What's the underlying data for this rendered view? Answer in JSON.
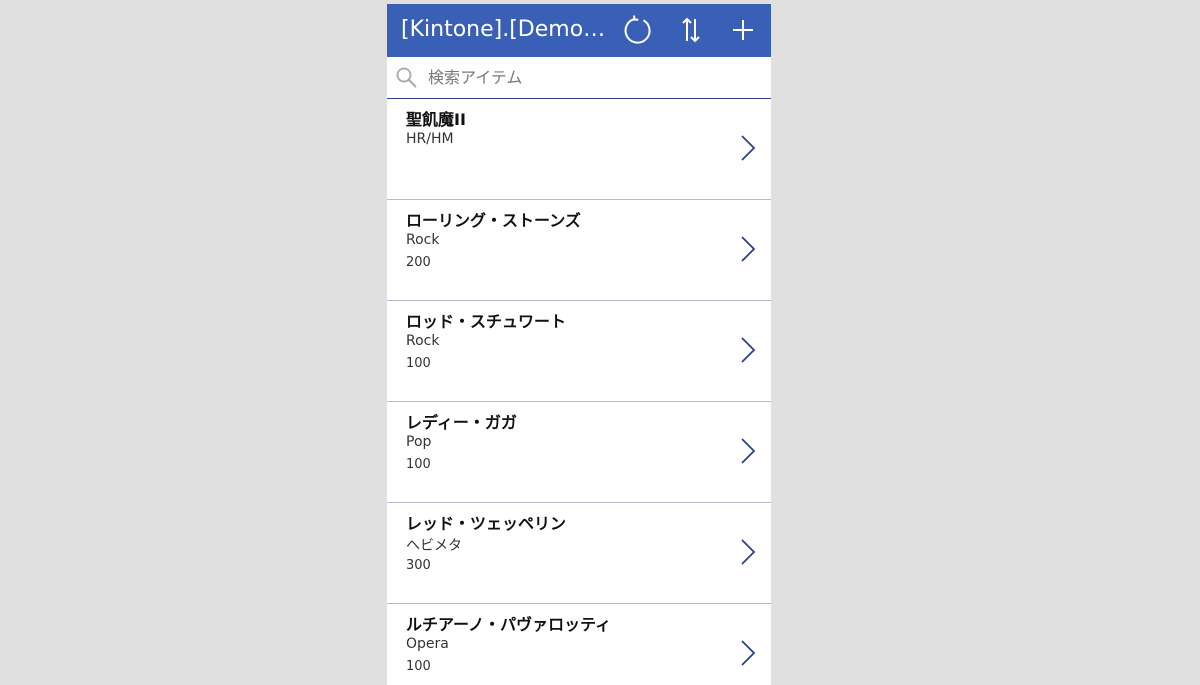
{
  "header": {
    "title": "[Kintone].[DemoC...",
    "refresh_icon": "refresh-icon",
    "sort_icon": "sort-icon",
    "add_icon": "add-icon",
    "background": "#3a5fb6"
  },
  "search": {
    "placeholder": "検索アイテム",
    "value": "",
    "icon": "search-icon"
  },
  "gallery": {
    "items": [
      {
        "title": "聖飢魔II",
        "subtitle": "HR/HM",
        "body": ""
      },
      {
        "title": "ローリング・ストーンズ",
        "subtitle": "Rock",
        "body": "200"
      },
      {
        "title": "ロッド・スチュワート",
        "subtitle": "Rock",
        "body": "100"
      },
      {
        "title": "レディー・ガガ",
        "subtitle": "Pop",
        "body": "100"
      },
      {
        "title": "レッド・ツェッペリン",
        "subtitle": "ヘビメタ",
        "body": "300"
      },
      {
        "title": "ルチアーノ・パヴァロッティ",
        "subtitle": "Opera",
        "body": "100"
      }
    ],
    "chevron_icon": "chevron-right-icon",
    "chevron_color": "#2b3f8a"
  }
}
